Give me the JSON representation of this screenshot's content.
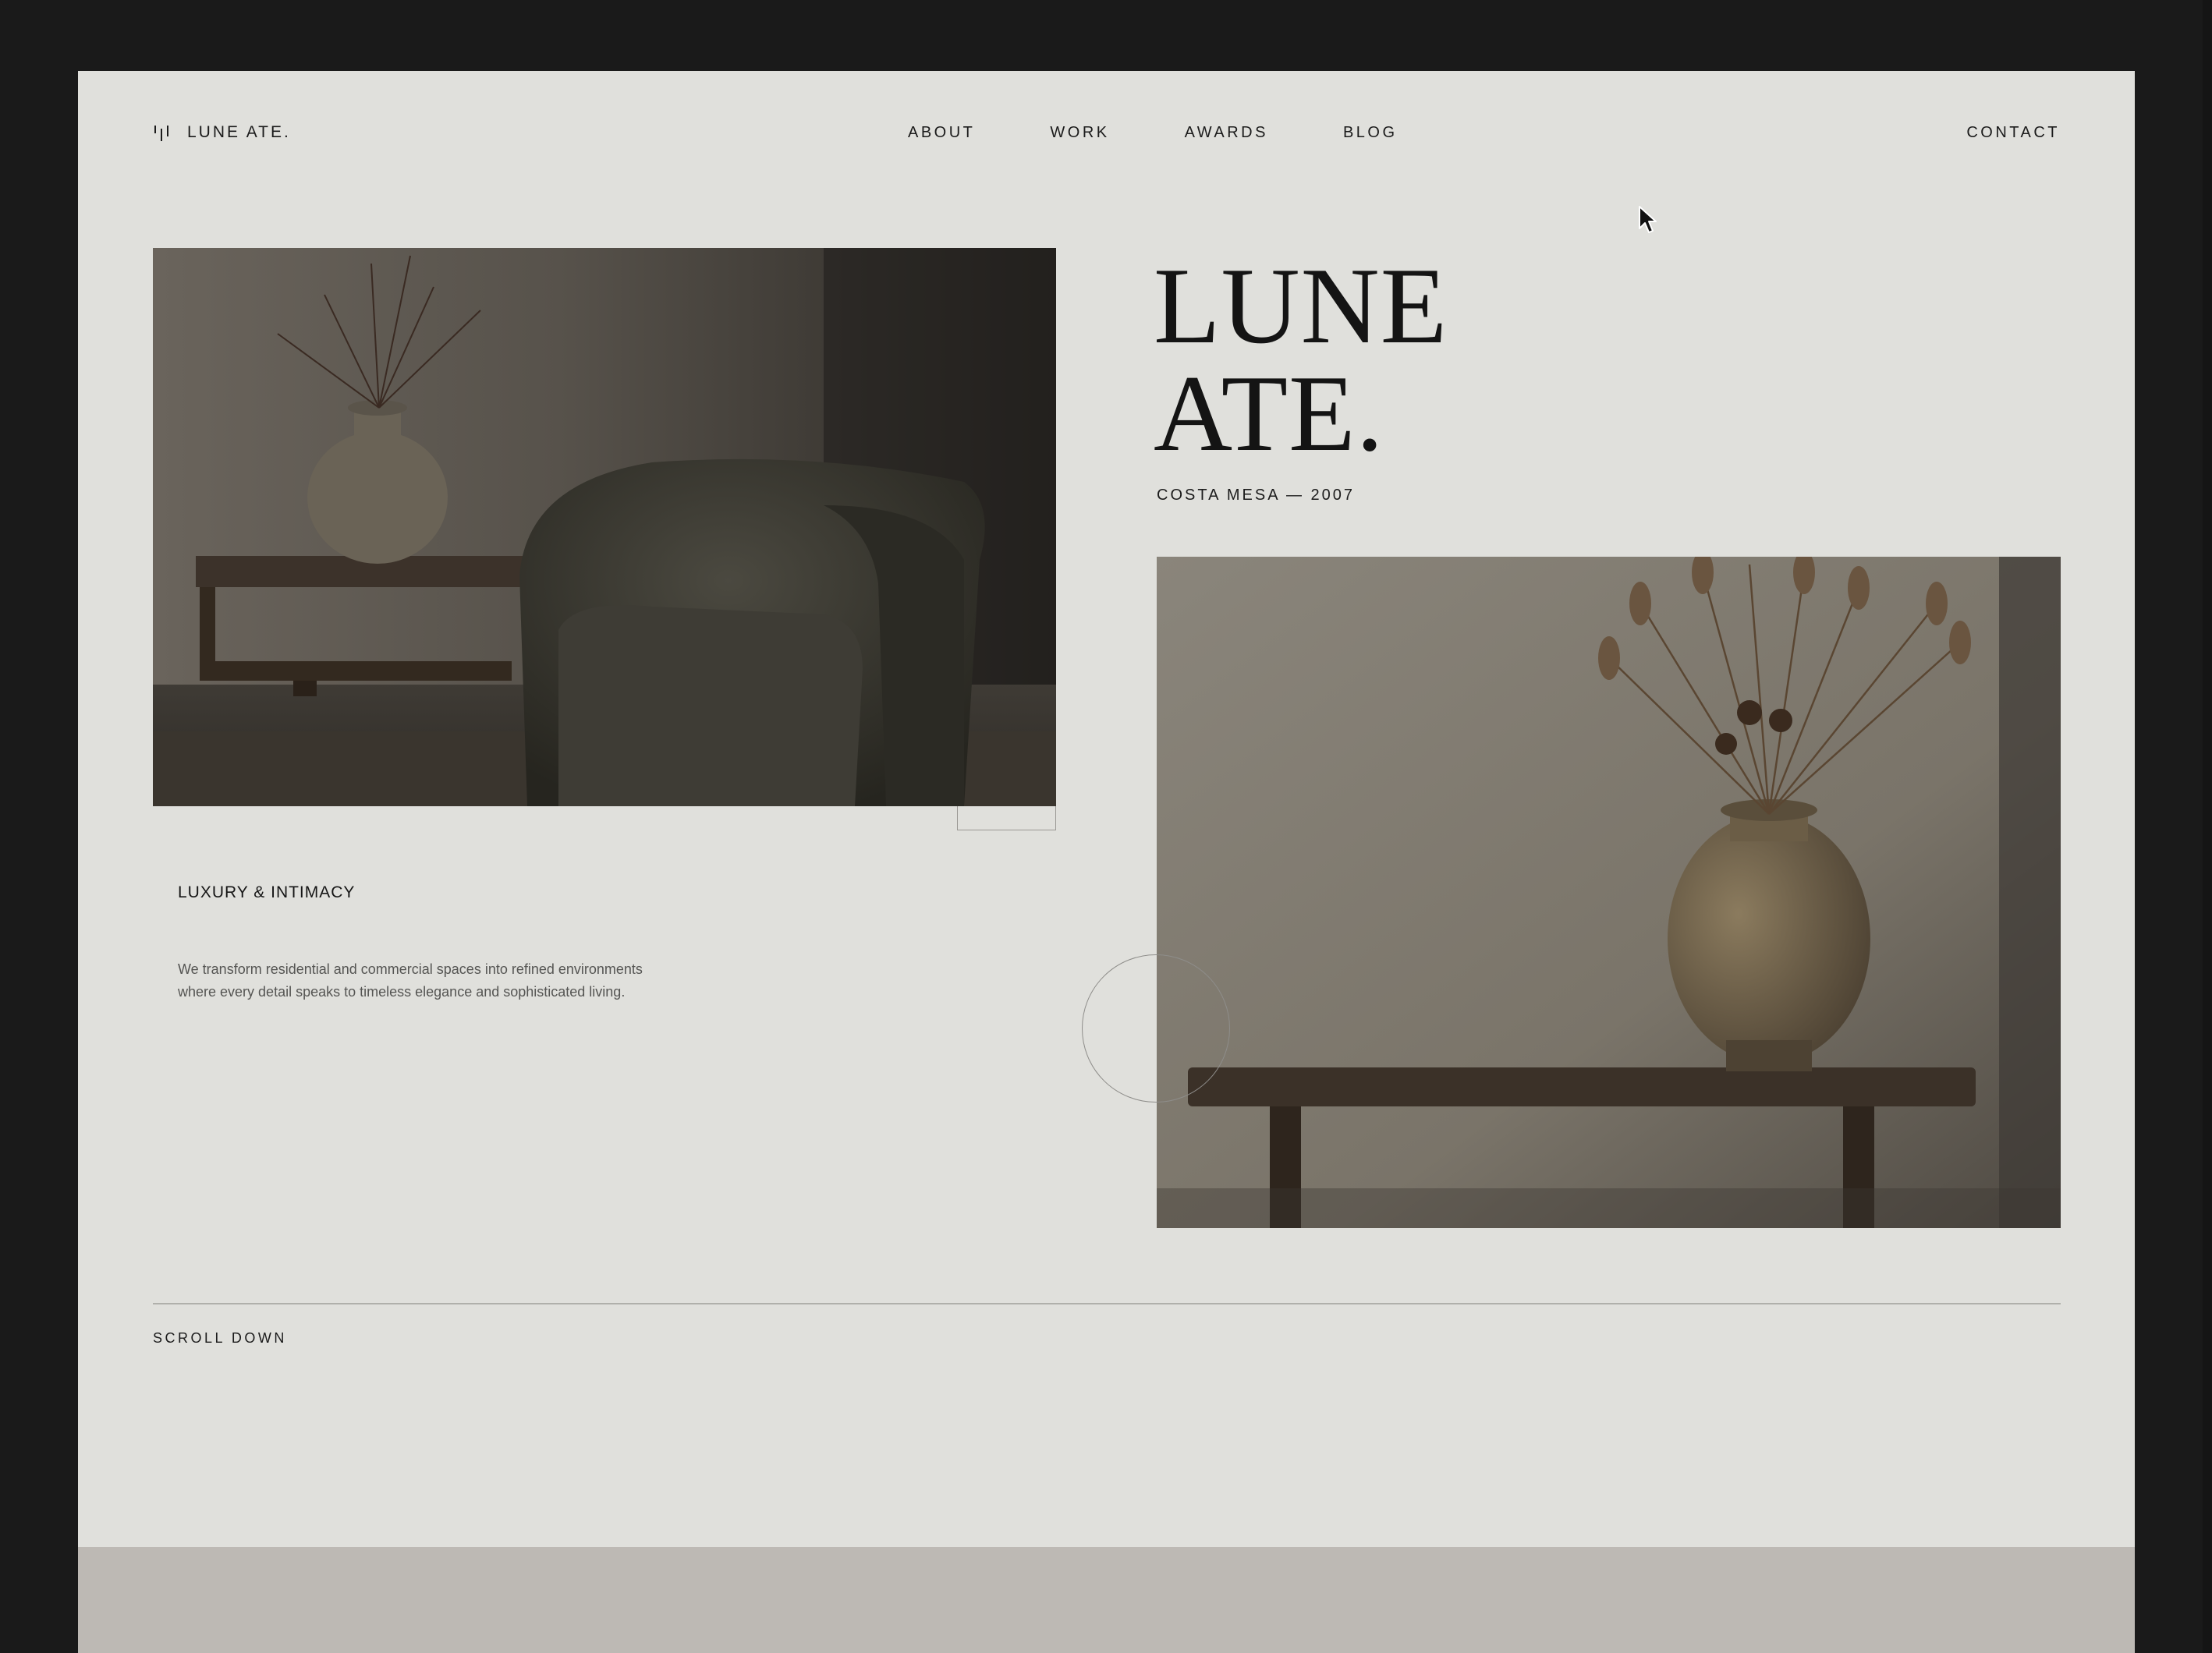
{
  "brand": {
    "name": "LUNE ATE."
  },
  "nav": {
    "items": [
      {
        "label": "ABOUT"
      },
      {
        "label": "WORK"
      },
      {
        "label": "AWARDS"
      },
      {
        "label": "BLOG"
      }
    ],
    "contact": "CONTACT"
  },
  "hero": {
    "title_line1": "LUNE",
    "title_line2": "ATE.",
    "subtitle": "COSTA MESA — 2007"
  },
  "intro": {
    "tagline": "LUXURY & INTIMACY",
    "description": "We transform residential and commercial spaces into refined environments where every detail speaks to timeless elegance and sophisticated living."
  },
  "footer": {
    "scroll_label": "SCROLL DOWN"
  },
  "colors": {
    "page_background": "#e0e0dc",
    "window_frame": "#1a1a1a",
    "text": "#1b1b1b",
    "footer_band": "#bdb9b4"
  }
}
